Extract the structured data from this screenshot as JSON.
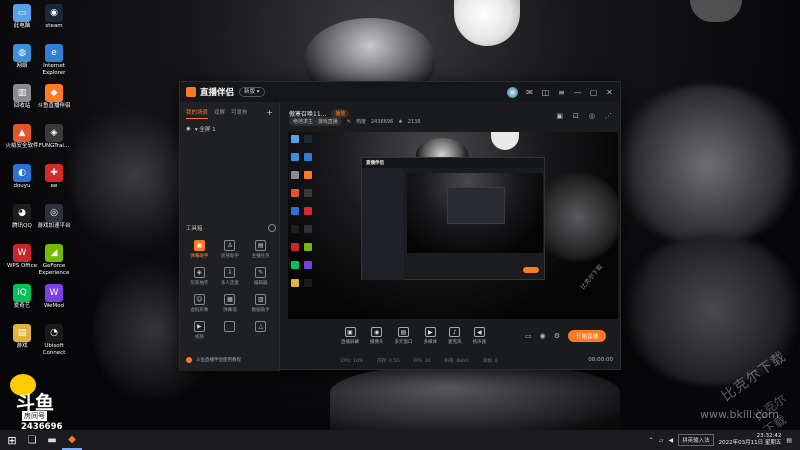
{
  "desktop": {
    "icons": [
      {
        "label": "此电脑",
        "color": "#5aa0e6",
        "glyph": "▭"
      },
      {
        "label": "steam",
        "color": "#1b2838",
        "glyph": "◉"
      },
      {
        "label": "网络",
        "color": "#3c8fd8",
        "glyph": "◍"
      },
      {
        "label": "Internet Explorer",
        "color": "#2f7fd4",
        "glyph": "e"
      },
      {
        "label": "回收站",
        "color": "#8a8a90",
        "glyph": "▥"
      },
      {
        "label": "斗鱼直播伴侣",
        "color": "#ff7a22",
        "glyph": "◆"
      },
      {
        "label": "火绒安全软件",
        "color": "#e0562b",
        "glyph": "▲"
      },
      {
        "label": "FUNGTrai...",
        "color": "#3a3a3a",
        "glyph": "◈"
      },
      {
        "label": "douyu",
        "color": "#2c72d6",
        "glyph": "◐"
      },
      {
        "label": "ee",
        "color": "#d42a2a",
        "glyph": "✚"
      },
      {
        "label": "腾讯QQ",
        "color": "#1e1e1e",
        "glyph": "◕"
      },
      {
        "label": "游戏加速平台",
        "color": "#30303a",
        "glyph": "◎"
      },
      {
        "label": "WPS Office",
        "color": "#c8252d",
        "glyph": "W"
      },
      {
        "label": "GeForce Experience",
        "color": "#76b900",
        "glyph": "◢"
      },
      {
        "label": "爱奇艺",
        "color": "#00c35a",
        "glyph": "iQ"
      },
      {
        "label": "WeMod",
        "color": "#7b3fe4",
        "glyph": "W"
      },
      {
        "label": "游戏",
        "color": "#e3b23c",
        "glyph": "▤"
      },
      {
        "label": "Ubisoft Connect",
        "color": "#1a1a1a",
        "glyph": "◔"
      }
    ],
    "douyu_brand": "斗鱼",
    "room_label": "房间号",
    "room_number": "2436696",
    "watermark_en": "www.bkill.com",
    "watermark_cn": "比克尔下载",
    "watermark_cn2": "比克尔下载"
  },
  "taskbar": {
    "pinned": [
      {
        "name": "windows-start-icon",
        "glyph": "⊞"
      },
      {
        "name": "task-view-icon",
        "glyph": "❏"
      },
      {
        "name": "file-explorer-icon",
        "glyph": "▬"
      },
      {
        "name": "douyu-app-icon",
        "glyph": "◆"
      }
    ],
    "tray": {
      "input_method": "拼英输入法",
      "time": "23:32:42",
      "date": "2022年03月11日 星期五"
    }
  },
  "app": {
    "title": "直播伴侣",
    "version": "新版 ▾",
    "sidebar": {
      "tabs": [
        "我的场景",
        "双屏",
        "可发布"
      ],
      "add": "+",
      "scene_name": "▾ 全屏 1",
      "tools_title": "工具箱",
      "tools": [
        {
          "label": "弹幕助手",
          "glyph": "▣",
          "hot": true
        },
        {
          "label": "房管助手",
          "glyph": "♙",
          "hot": false
        },
        {
          "label": "主播任务",
          "glyph": "▤",
          "hot": false
        },
        {
          "label": "玩家抽奖",
          "glyph": "◈",
          "hot": false
        },
        {
          "label": "多人连麦",
          "glyph": "⇩",
          "hot": false
        },
        {
          "label": "编辑器",
          "glyph": "✎",
          "hot": false
        },
        {
          "label": "虚拟形象",
          "glyph": "☺",
          "hot": false
        },
        {
          "label": "弹幕墙",
          "glyph": "▦",
          "hot": false
        },
        {
          "label": "数据助手",
          "glyph": "▥",
          "hot": false
        },
        {
          "label": "视频",
          "glyph": "▶",
          "hot": false
        },
        {
          "label": "",
          "glyph": "",
          "hot": false
        },
        {
          "label": "",
          "glyph": "△",
          "hot": false
        }
      ],
      "footer": "斗鱼直播伴侣使用教程"
    },
    "topbar": {
      "room_title": "傲寒召唤11...",
      "room_badge": "播放",
      "category_pill": "绝地求生 · 游戏直播",
      "edit": "✎",
      "hot_label": "热度",
      "hot_value": "2436696",
      "fans_icon": "♠",
      "fans_value": "2138"
    },
    "bottombar": {
      "buttons": [
        {
          "label": "直播屏幕",
          "glyph": "▣"
        },
        {
          "label": "摄像头",
          "glyph": "◉"
        },
        {
          "label": "多元窗口",
          "glyph": "▤"
        },
        {
          "label": "多媒体",
          "glyph": "▶"
        },
        {
          "label": "麦克风",
          "glyph": "♪"
        },
        {
          "label": "扬声器",
          "glyph": "◀"
        }
      ],
      "start_live": "开始直播"
    },
    "status": {
      "items": [
        "CPU: 10%",
        "内存: 4.5G",
        "FPS: 30",
        "码率: 0kb/s",
        "丢帧: 0"
      ],
      "timer": "00:00:00"
    }
  }
}
